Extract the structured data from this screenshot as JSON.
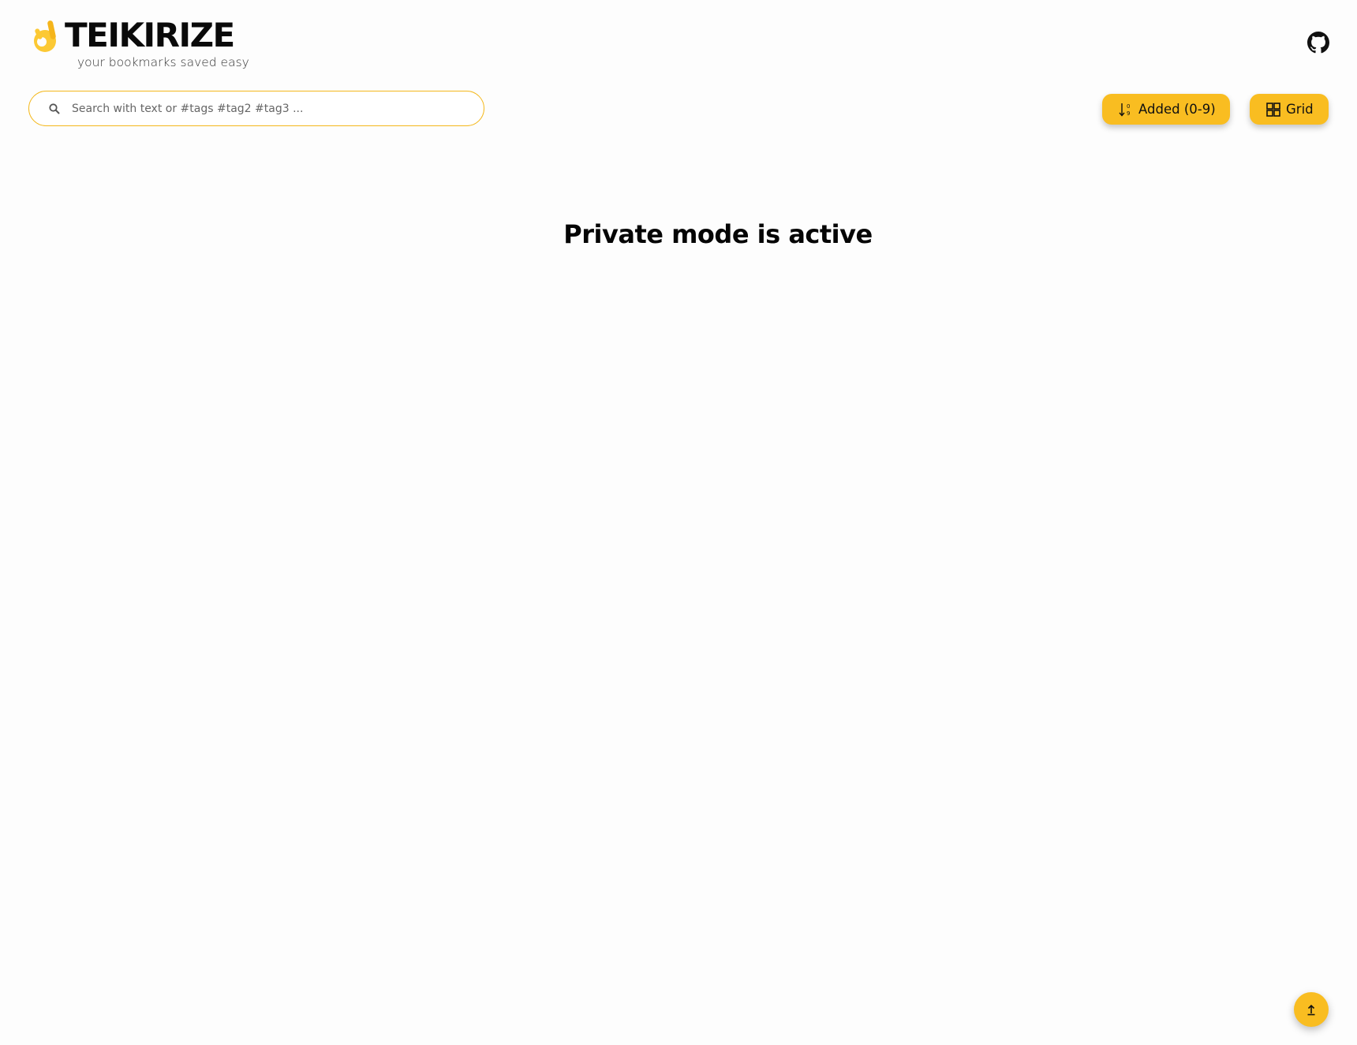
{
  "app": {
    "title": "TEIKIRIZE",
    "tagline": "your bookmarks saved easy"
  },
  "search": {
    "placeholder": "Search with text or #tags #tag2 #tag3 ...",
    "value": ""
  },
  "toolbar": {
    "sort_label": "Added (0-9)",
    "view_label": "Grid"
  },
  "main": {
    "message": "Private mode is active"
  },
  "icons": {
    "logo": "ok-hand-icon",
    "github": "github-icon",
    "search": "search-icon",
    "sort": "sort-numeric-down-icon",
    "view": "grid-icon",
    "scroll_top": "arrow-up-icon"
  },
  "colors": {
    "accent": "#f9bd21",
    "search_border": "#f4b81c",
    "background": "#fdfdfd",
    "text": "#111111"
  }
}
